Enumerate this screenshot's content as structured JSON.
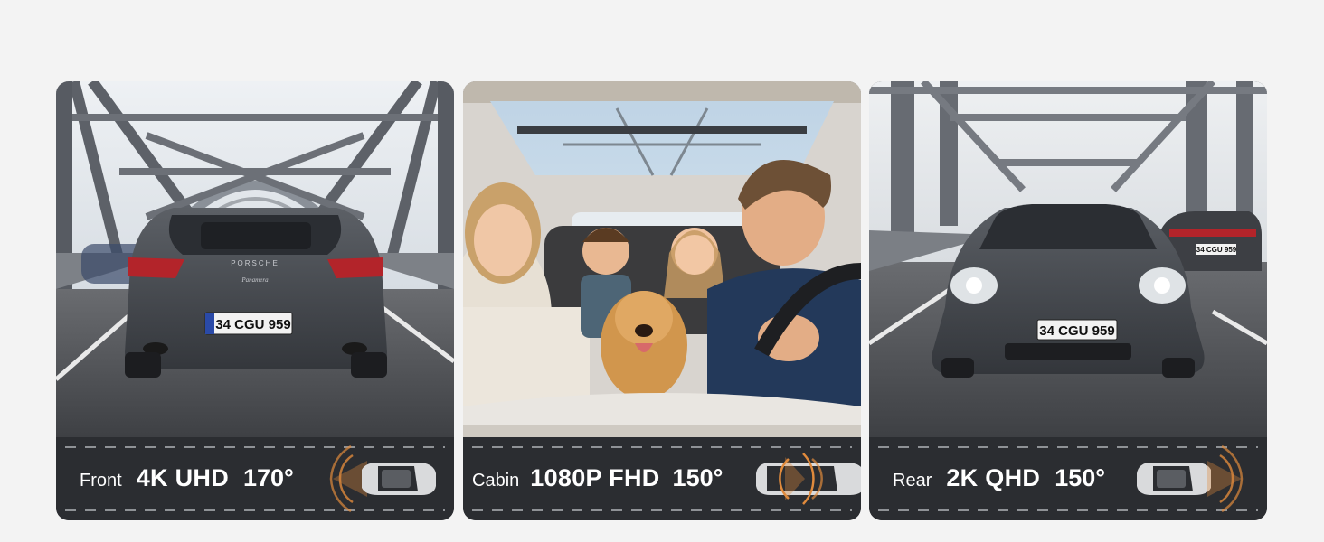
{
  "panels": [
    {
      "id": "front",
      "lens": "Front",
      "resolution": "4K UHD",
      "fov": "170°",
      "plate": "34 CGU 959",
      "car_brand": "PORSCHE",
      "car_model": "Panamera",
      "icon": "car-front-camera-icon"
    },
    {
      "id": "cabin",
      "lens": "Cabin",
      "resolution": "1080P FHD",
      "fov": "150°",
      "icon": "car-cabin-camera-icon"
    },
    {
      "id": "rear",
      "lens": "Rear",
      "resolution": "2K QHD",
      "fov": "150°",
      "plate": "34 CGU 959",
      "plate_small": "34 CGU 959",
      "icon": "car-rear-camera-icon"
    }
  ],
  "colors": {
    "background": "#f3f3f3",
    "caption_bar": "#2b2d31",
    "caption_text": "#ffffff",
    "camera_wave": "#e08a3c"
  }
}
